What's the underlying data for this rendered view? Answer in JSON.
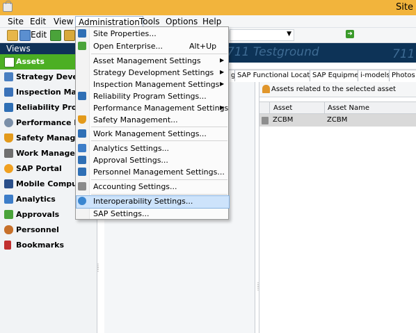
{
  "window": {
    "title": "Site"
  },
  "menubar": [
    {
      "id": "site",
      "label": "Site"
    },
    {
      "id": "edit",
      "label": "Edit"
    },
    {
      "id": "view",
      "label": "View"
    },
    {
      "id": "administration",
      "label": "Administration"
    },
    {
      "id": "tools",
      "label": "Tools"
    },
    {
      "id": "options",
      "label": "Options"
    },
    {
      "id": "help",
      "label": "Help"
    }
  ],
  "toolbar": {
    "edit_label": "Edit"
  },
  "sidebar": {
    "header": "Views",
    "selected": "Assets",
    "items": [
      {
        "label": "Strategy Develop",
        "icon": "strategy-icon",
        "color": "#4a7fc1"
      },
      {
        "label": "Inspection Manag",
        "icon": "inspection-icon",
        "color": "#3b72b8"
      },
      {
        "label": "Reliability Progra",
        "icon": "reliability-icon",
        "color": "#2f6fb5"
      },
      {
        "label": "Performance Ma",
        "icon": "performance-icon",
        "color": "#7b8fa8"
      },
      {
        "label": "Safety Managem",
        "icon": "safety-icon",
        "color": "#e39a1b"
      },
      {
        "label": "Work Manageme",
        "icon": "work-icon",
        "color": "#6f6f6f"
      },
      {
        "label": "SAP Portal",
        "icon": "sap-portal-icon",
        "color": "#f0a020"
      },
      {
        "label": "Mobile Computin",
        "icon": "mobile-icon",
        "color": "#2a4f8a"
      },
      {
        "label": "Analytics",
        "icon": "analytics-icon",
        "color": "#3d7dc8"
      },
      {
        "label": "Approvals",
        "icon": "approvals-icon",
        "color": "#4aa33a"
      },
      {
        "label": "Personnel",
        "icon": "personnel-icon",
        "color": "#c7702a"
      },
      {
        "label": "Bookmarks",
        "icon": "bookmarks-icon",
        "color": "#c12f2f"
      }
    ]
  },
  "banner": {
    "watermark": "711 Testground"
  },
  "tabs": [
    {
      "label": "g"
    },
    {
      "label": "SAP Functional Locations"
    },
    {
      "label": "SAP Equipment"
    },
    {
      "label": "i-models"
    },
    {
      "label": "Photos"
    }
  ],
  "right_pane": {
    "header": "Assets related to the selected asset",
    "columns": [
      "Asset",
      "Asset Name"
    ],
    "rows": [
      {
        "asset": "ZCBM",
        "asset_name": "ZCBM"
      }
    ]
  },
  "admin_menu": {
    "items": [
      {
        "label": "Site Properties...",
        "icon": "site-properties-icon",
        "color": "#2f6fb5"
      },
      {
        "label": "Open Enterprise...",
        "shortcut": "Alt+Up",
        "icon": "open-enterprise-icon",
        "color": "#4aa33a"
      },
      {
        "separator": true
      },
      {
        "label": "Asset Management Settings",
        "submenu": true
      },
      {
        "label": "Strategy Development Settings",
        "submenu": true
      },
      {
        "label": "Inspection Management Settings",
        "submenu": true
      },
      {
        "label": "Reliability Program Settings...",
        "icon": "reliability-settings-icon",
        "color": "#2f6fb5"
      },
      {
        "label": "Performance Management Settings",
        "submenu": true
      },
      {
        "label": "Safety Management...",
        "icon": "safety-management-icon",
        "color": "#e39a1b"
      },
      {
        "separator": true
      },
      {
        "label": "Work Management Settings...",
        "icon": "work-settings-icon",
        "color": "#2f6fb5"
      },
      {
        "separator": true
      },
      {
        "label": "Analytics Settings...",
        "icon": "analytics-settings-icon",
        "color": "#3d7dc8"
      },
      {
        "label": "Approval Settings...",
        "icon": "approval-settings-icon",
        "color": "#2f6fb5"
      },
      {
        "label": "Personnel Management Settings...",
        "icon": "personnel-settings-icon",
        "color": "#2f6fb5"
      },
      {
        "separator": true
      },
      {
        "label": "Accounting Settings...",
        "icon": "accounting-settings-icon",
        "color": "#8a8a8a"
      },
      {
        "separator": true
      },
      {
        "label": "Interoperability Settings...",
        "icon": "interoperability-icon",
        "color": "#3a86d0",
        "highlighted": true
      },
      {
        "label": "SAP Settings..."
      }
    ]
  },
  "colors": {
    "title_bar": "#f2b43c",
    "views_header": "#0f3258",
    "selected_nav": "#4caf23",
    "banner": "#0d3357",
    "menu_highlight": "#cde3fb"
  }
}
